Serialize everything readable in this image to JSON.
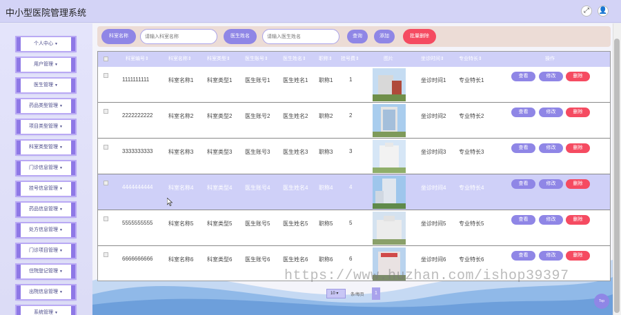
{
  "app": {
    "title": "中小型医院管理系统"
  },
  "header": {
    "expand_icon": "fullscreen-icon",
    "user_icon": "user-icon"
  },
  "sidebar": {
    "items": [
      {
        "label": "个人中心"
      },
      {
        "label": "用户管理"
      },
      {
        "label": "医生管理"
      },
      {
        "label": "药品类型管理"
      },
      {
        "label": "项目类型管理"
      },
      {
        "label": "科室类型管理"
      },
      {
        "label": "门诊信息管理"
      },
      {
        "label": "挂号信息管理"
      },
      {
        "label": "药品信息管理"
      },
      {
        "label": "处方信息管理"
      },
      {
        "label": "门诊项目管理"
      },
      {
        "label": "住院登记管理"
      },
      {
        "label": "出院信息管理"
      },
      {
        "label": "系统管理"
      }
    ]
  },
  "search": {
    "dept_label": "科室名称",
    "dept_placeholder": "请输入科室名称",
    "doctor_label": "医生姓名",
    "doctor_placeholder": "请输入医生姓名",
    "query_button": "查询",
    "add_button": "添加",
    "batch_delete_button": "批量删除"
  },
  "table": {
    "columns": [
      "科室编号",
      "科室名称",
      "科室类型",
      "医生账号",
      "医生姓名",
      "职称",
      "挂号费",
      "图片",
      "坐诊时间",
      "专业特长",
      "操作"
    ],
    "actions": {
      "view": "查看",
      "edit": "修改",
      "delete": "删除"
    },
    "rows": [
      {
        "dept_id": "1111111111",
        "dept_name": "科室名称1",
        "dept_type": "科室类型1",
        "doctor_account": "医生账号1",
        "doctor_name": "医生姓名1",
        "title": "职称1",
        "fee": "1",
        "time": "坐诊时间1",
        "specialty": "专业特长1"
      },
      {
        "dept_id": "2222222222",
        "dept_name": "科室名称2",
        "dept_type": "科室类型2",
        "doctor_account": "医生账号2",
        "doctor_name": "医生姓名2",
        "title": "职称2",
        "fee": "2",
        "time": "坐诊时间2",
        "specialty": "专业特长2"
      },
      {
        "dept_id": "3333333333",
        "dept_name": "科室名称3",
        "dept_type": "科室类型3",
        "doctor_account": "医生账号3",
        "doctor_name": "医生姓名3",
        "title": "职称3",
        "fee": "3",
        "time": "坐诊时间3",
        "specialty": "专业特长3"
      },
      {
        "dept_id": "4444444444",
        "dept_name": "科室名称4",
        "dept_type": "科室类型4",
        "doctor_account": "医生账号4",
        "doctor_name": "医生姓名4",
        "title": "职称4",
        "fee": "4",
        "time": "坐诊时间4",
        "specialty": "专业特长4"
      },
      {
        "dept_id": "5555555555",
        "dept_name": "科室名称5",
        "dept_type": "科室类型5",
        "doctor_account": "医生账号5",
        "doctor_name": "医生姓名5",
        "title": "职称5",
        "fee": "5",
        "time": "坐诊时间5",
        "specialty": "专业特长5"
      },
      {
        "dept_id": "6666666666",
        "dept_name": "科室名称6",
        "dept_type": "科室类型6",
        "doctor_account": "医生账号6",
        "doctor_name": "医生姓名6",
        "title": "职称6",
        "fee": "6",
        "time": "坐诊时间6",
        "specialty": "专业特长6"
      }
    ]
  },
  "pagination": {
    "page_size": "10",
    "per_page_label": "条/每页",
    "current_page": "1"
  },
  "top_button": "Top",
  "watermark": "https://www.huzhan.com/ishop39397",
  "colors": {
    "accent": "#8f86e6",
    "danger": "#f54b61",
    "header_bg": "#d3d3f6",
    "highlight_row": "#cfd0f8"
  }
}
